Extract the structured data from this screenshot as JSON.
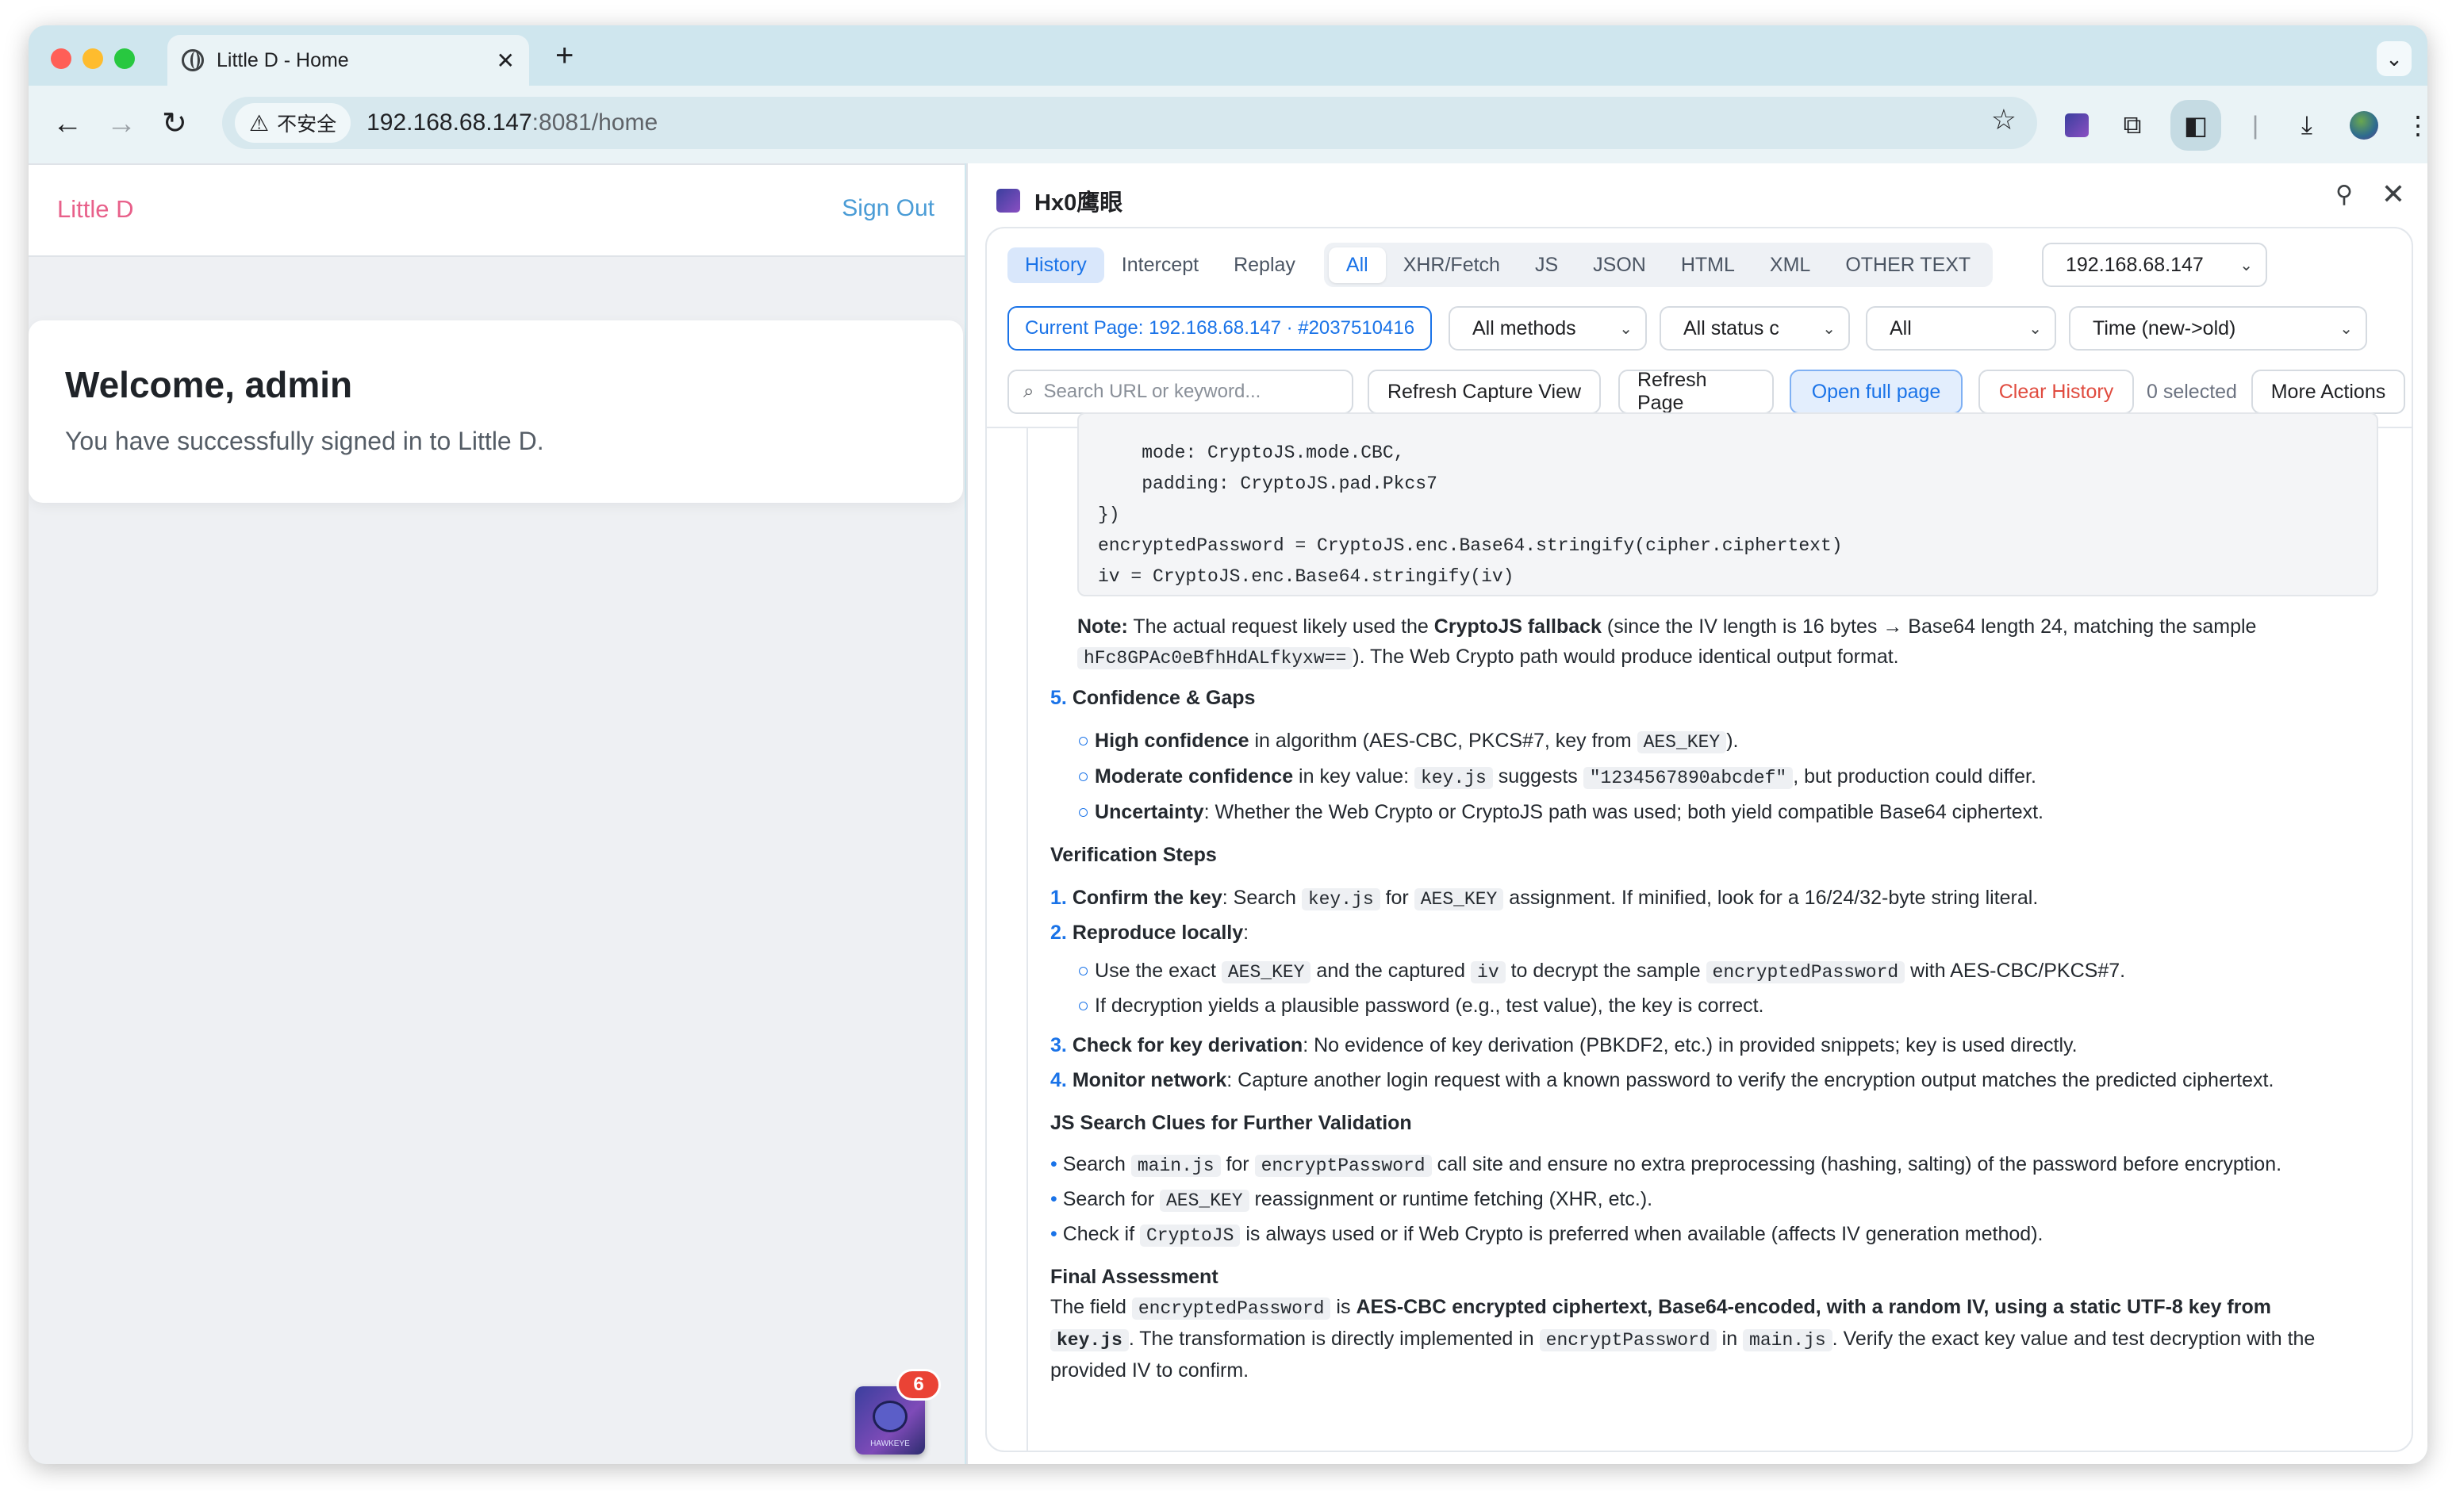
{
  "browser": {
    "tab_title": "Little D - Home",
    "tab_close": "✕",
    "new_tab": "+",
    "security_label": "不安全",
    "url_host": "192.168.68.147",
    "url_rest": ":8081/home"
  },
  "site": {
    "brand": "Little D",
    "sign_out": "Sign Out",
    "welcome": "Welcome, admin",
    "message": "You have successfully signed in to Little D.",
    "badge_count": "6",
    "avatar_caption": "HAWKEYE"
  },
  "panel": {
    "title": "Hx0鹰眼",
    "mode_tabs": [
      "History",
      "Intercept",
      "Replay"
    ],
    "type_tabs": [
      "All",
      "XHR/Fetch",
      "JS",
      "JSON",
      "HTML",
      "XML",
      "OTHER TEXT"
    ],
    "host_select": "192.168.68.147",
    "current_page": "Current Page: 192.168.68.147 · #2037510416",
    "methods_select": "All methods",
    "status_select": "All status c",
    "all_select": "All",
    "sort_select": "Time (new->old)",
    "search_placeholder": "Search URL or keyword...",
    "refresh_capture": "Refresh Capture View",
    "refresh_page": "Refresh Page",
    "open_full": "Open full page",
    "clear_history": "Clear History",
    "selected": "0 selected",
    "more_actions": "More Actions"
  },
  "analysis": {
    "code_lines": [
      "    mode: CryptoJS.mode.CBC,",
      "    padding: CryptoJS.pad.Pkcs7",
      "})",
      "encryptedPassword = CryptoJS.enc.Base64.stringify(cipher.ciphertext)",
      "iv = CryptoJS.enc.Base64.stringify(iv)"
    ],
    "note_label": "Note:",
    "note_a": " The actual request likely used the ",
    "note_b": "CryptoJS fallback",
    "note_c": " (since the IV length is 16 bytes → Base64 length 24, matching the sample",
    "note_code": "hFc8GPAc0eBfhHdALfkyxw==",
    "note_d": "). The Web Crypto path would produce identical output format.",
    "sec5_num": "5.",
    "sec5_title": "Confidence & Gaps",
    "conf1_b": "High confidence",
    "conf1_a": " in algorithm (AES-CBC, PKCS#7, key from ",
    "conf1_code": "AES_KEY",
    "conf1_c": ").",
    "conf2_b": "Moderate confidence",
    "conf2_a": " in key value: ",
    "conf2_code1": "key.js",
    "conf2_m": " suggests ",
    "conf2_code2": "\"1234567890abcdef\"",
    "conf2_c": ", but production could differ.",
    "conf3_b": "Uncertainty",
    "conf3_a": ": Whether the Web Crypto or CryptoJS path was used; both yield compatible Base64 ciphertext.",
    "verify_title": "Verification Steps",
    "v1_num": "1.",
    "v1_b": "Confirm the key",
    "v1_a": ": Search ",
    "v1_code1": "key.js",
    "v1_m": " for ",
    "v1_code2": "AES_KEY",
    "v1_c": " assignment. If minified, look for a 16/24/32-byte string literal.",
    "v2_num": "2.",
    "v2_b": "Reproduce locally",
    "v2_a": ":",
    "v2s1_a": "Use the exact ",
    "v2s1_code1": "AES_KEY",
    "v2s1_m": " and the captured ",
    "v2s1_code2": "iv",
    "v2s1_m2": " to decrypt the sample ",
    "v2s1_code3": "encryptedPassword",
    "v2s1_c": " with AES-CBC/PKCS#7.",
    "v2s2": "If decryption yields a plausible password (e.g., test value), the key is correct.",
    "v3_num": "3.",
    "v3_b": "Check for key derivation",
    "v3_a": ": No evidence of key derivation (PBKDF2, etc.) in provided snippets; key is used directly.",
    "v4_num": "4.",
    "v4_b": "Monitor network",
    "v4_a": ": Capture another login request with a known password to verify the encryption output matches the predicted ciphertext.",
    "clues_title": "JS Search Clues for Further Validation",
    "c1_a": "Search ",
    "c1_code1": "main.js",
    "c1_m": " for ",
    "c1_code2": "encryptPassword",
    "c1_c": " call site and ensure no extra preprocessing (hashing, salting) of the password before encryption.",
    "c2_a": "Search for ",
    "c2_code": "AES_KEY",
    "c2_c": " reassignment or runtime fetching (XHR, etc.).",
    "c3_a": "Check if ",
    "c3_code": "CryptoJS",
    "c3_c": " is always used or if Web Crypto is preferred when available (affects IV generation method).",
    "final_title": "Final Assessment",
    "f1_a": "The field ",
    "f1_code": "encryptedPassword",
    "f1_m": " is ",
    "f1_b": "AES-CBC encrypted ciphertext, Base64-encoded, with a random IV, using a static UTF-8 key from",
    "f2_code1": "key.js",
    "f2_a": ". The transformation is directly implemented in ",
    "f2_code2": "encryptPassword",
    "f2_m": " in ",
    "f2_code3": "main.js",
    "f2_c": ". Verify the exact key value and test decryption with the",
    "f3": "provided IV to confirm."
  },
  "colors": {
    "brand": "#e8608a",
    "link": "#4a9cd6",
    "accent": "#1a73e8",
    "danger": "#e04b3f",
    "badge": "#ea4335"
  }
}
